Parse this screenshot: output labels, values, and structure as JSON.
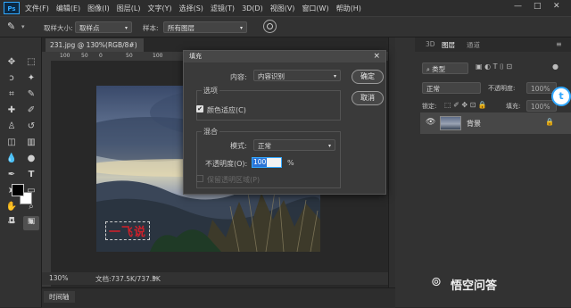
{
  "app": {
    "logo": "Ps"
  },
  "menu": [
    "文件(F)",
    "编辑(E)",
    "图像(I)",
    "图层(L)",
    "文字(Y)",
    "选择(S)",
    "滤镜(T)",
    "3D(D)",
    "视图(V)",
    "窗口(W)",
    "帮助(H)"
  ],
  "window_controls": {
    "minimize": "—",
    "maximize": "□",
    "close": "✕"
  },
  "options_bar": {
    "sample_size_label": "取样大小:",
    "sample_size_value": "取样点",
    "sample_label": "样本:",
    "sample_value": "所有图层"
  },
  "document": {
    "tab_title": "231.jpg @ 130%(RGB/8#)",
    "tab_close": "×",
    "ruler_marks": [
      "100",
      "50",
      "0",
      "50",
      "100",
      "150",
      "200",
      "250",
      "300",
      "350"
    ],
    "canvas_text": "一飞说",
    "zoom": "130%",
    "doc_info": "文档:737.5K/737.5K"
  },
  "timeline": {
    "label": "时间轴"
  },
  "dialog": {
    "title": "填充",
    "close": "×",
    "content_label": "内容:",
    "content_value": "内容识别",
    "ok": "确定",
    "cancel": "取消",
    "options_group": "选项",
    "color_adapt_label": "颜色适应(C)",
    "color_adapt_checked": true,
    "blend_group": "混合",
    "mode_label": "模式:",
    "mode_value": "正常",
    "opacity_label": "不透明度(O):",
    "opacity_value": "100",
    "opacity_unit": "%",
    "preserve_label": "保留透明区域(P)"
  },
  "panels": {
    "tabs": [
      "3D",
      "图层",
      "通道"
    ],
    "active_tab": "图层",
    "kind_filter": "类型",
    "blend_mode": "正常",
    "opacity_label": "不透明度:",
    "opacity_value": "100%",
    "lock_label": "锁定:",
    "fill_label": "填充:",
    "fill_value": "100%",
    "layers": [
      {
        "name": "背景",
        "visible": true,
        "locked": true
      }
    ]
  },
  "watermark": {
    "text": "悟空问答"
  },
  "colors": {
    "accent": "#31a8ff",
    "canvas_text": "#d0202a"
  }
}
